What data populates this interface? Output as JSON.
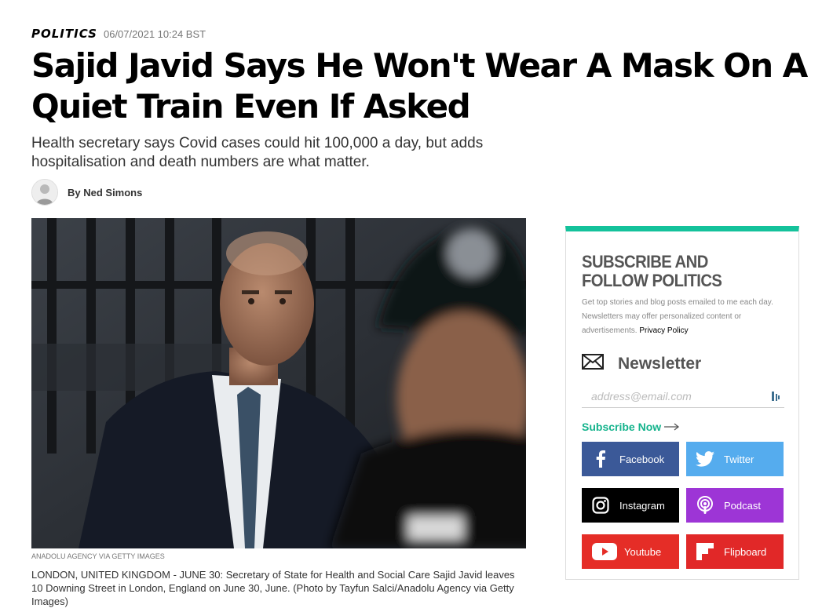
{
  "article": {
    "section": "POLITICS",
    "timestamp": "06/07/2021 10:24 BST",
    "headline": "Sajid Javid Says He Won't Wear A Mask On A Quiet Train Even If Asked",
    "dek": "Health secretary says Covid cases could hit 100,000 a day, but adds hospitalisation and death numbers are what matter.",
    "byline": "By Ned Simons",
    "photo_credit": "ANADOLU AGENCY VIA GETTY IMAGES",
    "caption": "LONDON, UNITED KINGDOM - JUNE 30: Secretary of State for Health and Social Care Sajid Javid leaves 10 Downing Street in London, England on June 30, June. (Photo by Tayfun Salci/Anadolu Agency via Getty Images)"
  },
  "sidebar": {
    "title": "SUBSCRIBE AND FOLLOW POLITICS",
    "description": "Get top stories and blog posts emailed to me each day. Newsletters may offer personalized content or advertisements.",
    "privacy_link": "Privacy Policy",
    "newsletter_label": "Newsletter",
    "email_placeholder": "address@email.com",
    "subscribe_label": "Subscribe Now",
    "accent_color": "#14c29b",
    "social": [
      {
        "label": "Facebook",
        "icon": "facebook-icon",
        "color": "#3b5998"
      },
      {
        "label": "Twitter",
        "icon": "twitter-icon",
        "color": "#55acee"
      },
      {
        "label": "Instagram",
        "icon": "instagram-icon",
        "color": "#000000"
      },
      {
        "label": "Podcast",
        "icon": "podcast-icon",
        "color": "#9d35d6"
      },
      {
        "label": "Youtube",
        "icon": "youtube-icon",
        "color": "#e52d27"
      },
      {
        "label": "Flipboard",
        "icon": "flipboard-icon",
        "color": "#e12828"
      }
    ]
  }
}
